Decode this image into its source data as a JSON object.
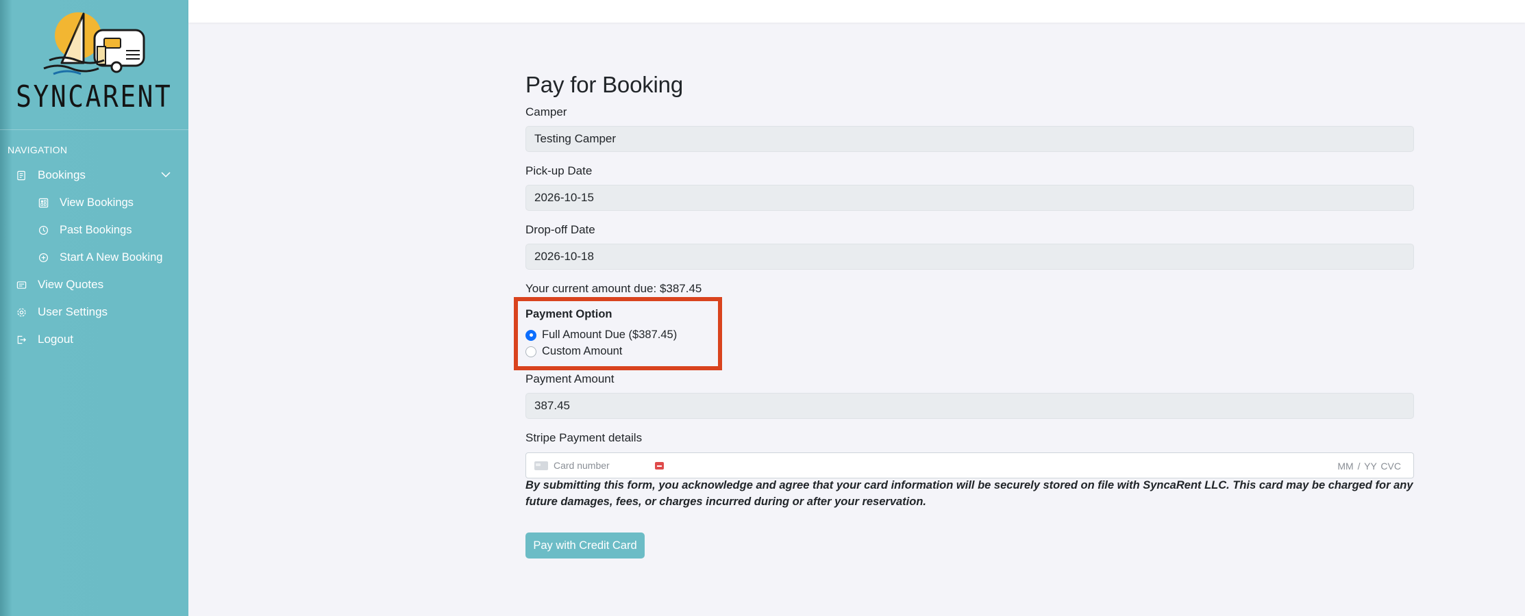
{
  "app": {
    "brand": "SYNCARENT",
    "accent_color": "#6cbcc6",
    "highlight_color": "#d9431e"
  },
  "sidebar": {
    "heading": "NAVIGATION",
    "items": [
      {
        "label": "Bookings",
        "icon": "bookings-icon",
        "expandable": true
      },
      {
        "label": "View Bookings",
        "icon": "calendar-grid-icon"
      },
      {
        "label": "Past Bookings",
        "icon": "clock-icon"
      },
      {
        "label": "Start A New Booking",
        "icon": "plus-circle-icon"
      },
      {
        "label": "View Quotes",
        "icon": "quote-card-icon"
      },
      {
        "label": "User Settings",
        "icon": "gear-icon"
      },
      {
        "label": "Logout",
        "icon": "logout-icon"
      }
    ]
  },
  "form": {
    "title": "Pay for Booking",
    "camper": {
      "label": "Camper",
      "value": "Testing Camper"
    },
    "pickup": {
      "label": "Pick-up Date",
      "value": "2026-10-15"
    },
    "dropoff": {
      "label": "Drop-off Date",
      "value": "2026-10-18"
    },
    "amount_due_text": "Your current amount due: $387.45",
    "payment_option": {
      "title": "Payment Option",
      "options": [
        {
          "label": "Full Amount Due ($387.45)",
          "checked": true
        },
        {
          "label": "Custom Amount",
          "checked": false
        }
      ]
    },
    "payment_amount": {
      "label": "Payment Amount",
      "value": "387.45"
    },
    "stripe": {
      "label": "Stripe Payment details",
      "card_placeholder": "Card number",
      "expiry_cvc_placeholder": "MM / YY  CVC"
    },
    "notice": "By submitting this form, you acknowledge and agree that your card information will be securely stored on file with SyncaRent LLC. This card may be charged for any future damages, fees, or charges incurred during or after your reservation.",
    "submit_label": "Pay with Credit Card"
  }
}
